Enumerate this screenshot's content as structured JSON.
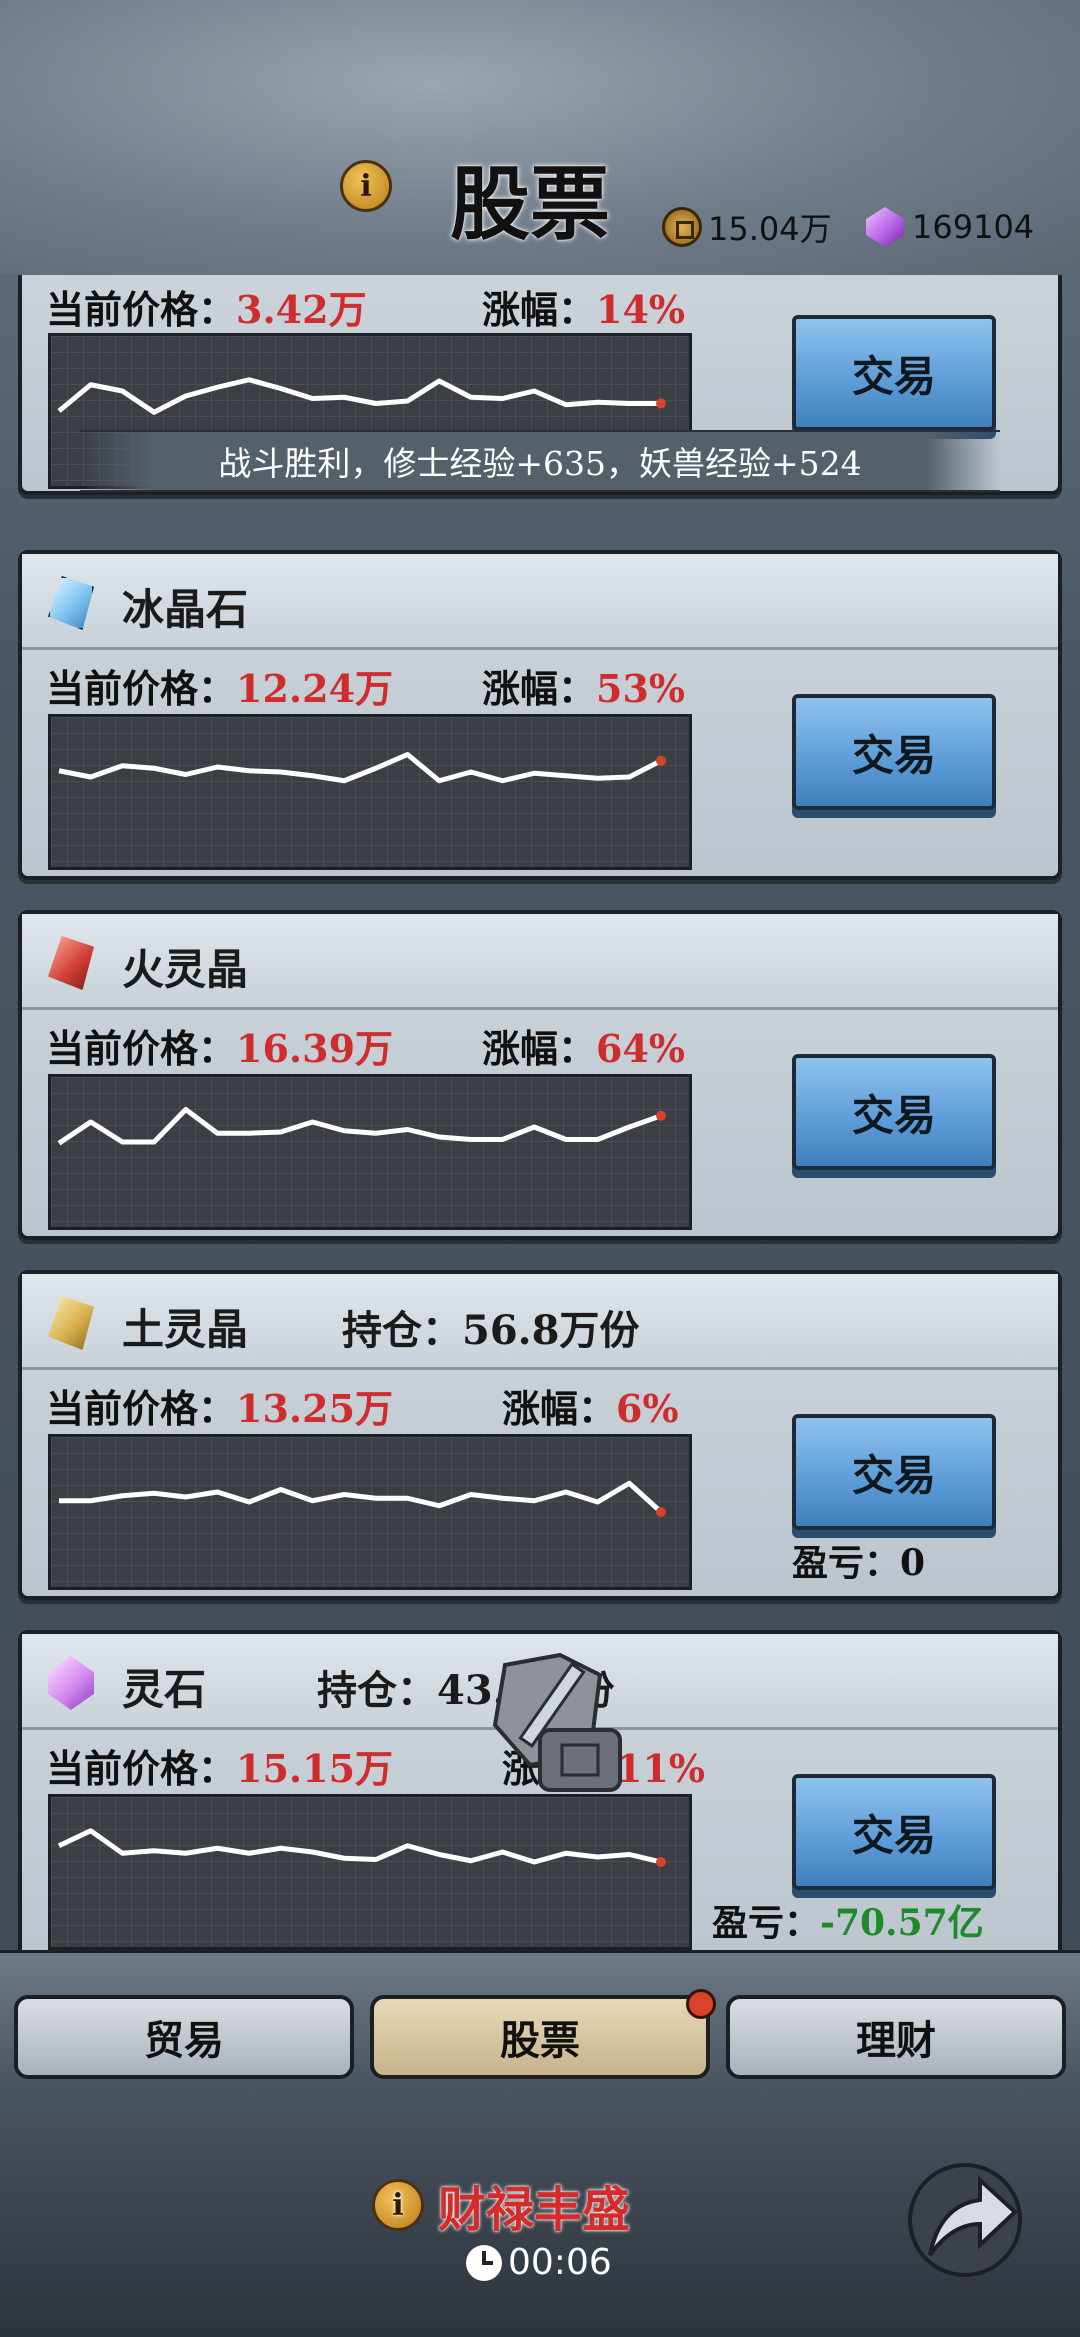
{
  "header": {
    "title": "股票",
    "coins": "15.04万",
    "gems": "169104"
  },
  "toast": "战斗胜利，修士经验+635，妖兽经验+524",
  "labels": {
    "price": "当前价格：",
    "change": "涨幅：",
    "hold": "持仓：",
    "pl": "盈亏：",
    "trade": "交易"
  },
  "stocks": [
    {
      "name": "",
      "price": "3.42万",
      "change": "14%",
      "icon": "none",
      "series": [
        6.0,
        8.1,
        7.6,
        5.9,
        7.2,
        7.9,
        8.5,
        7.8,
        7.0,
        7.1,
        6.6,
        6.8,
        8.4,
        7.1,
        7.0,
        7.6,
        6.5,
        6.7,
        6.6,
        6.6
      ]
    },
    {
      "name": "冰晶石",
      "price": "12.24万",
      "change": "53%",
      "icon": "ice-crystal-icon",
      "series": [
        7.7,
        7.2,
        8.1,
        7.9,
        7.4,
        8.0,
        7.7,
        7.6,
        7.3,
        6.9,
        7.9,
        9.0,
        6.9,
        7.6,
        6.9,
        7.5,
        7.3,
        7.1,
        7.2,
        8.5
      ]
    },
    {
      "name": "火灵晶",
      "price": "16.39万",
      "change": "64%",
      "icon": "fire-crystal-icon",
      "series": [
        6.7,
        8.4,
        6.8,
        6.8,
        9.4,
        7.5,
        7.5,
        7.6,
        8.4,
        7.7,
        7.5,
        7.8,
        7.2,
        7.0,
        7.0,
        8.0,
        7.0,
        7.0,
        8.0,
        8.9
      ]
    },
    {
      "name": "土灵晶",
      "price": "13.25万",
      "change": "6%",
      "icon": "earth-crystal-icon",
      "hold": "56.8万份",
      "pl": "0",
      "plColor": "#111111",
      "series": [
        6.9,
        6.9,
        7.3,
        7.5,
        7.2,
        7.6,
        6.8,
        7.8,
        6.9,
        7.4,
        7.1,
        7.1,
        6.5,
        7.4,
        7.1,
        6.9,
        7.6,
        6.8,
        8.3,
        6.0
      ]
    },
    {
      "name": "灵石",
      "price": "15.15万",
      "change": "11%",
      "icon": "spirit-stone-icon",
      "hold": "43.4万份",
      "pl": "-70.57亿",
      "plColor": "#1f8a2c",
      "series": [
        8.1,
        9.3,
        7.5,
        7.7,
        7.5,
        7.9,
        7.5,
        7.9,
        7.6,
        7.1,
        7.0,
        8.1,
        7.4,
        6.9,
        7.6,
        6.8,
        7.5,
        7.2,
        7.4,
        6.8
      ]
    }
  ],
  "tabs": [
    {
      "label": "贸易",
      "active": false
    },
    {
      "label": "股票",
      "active": true
    },
    {
      "label": "理财",
      "active": false
    }
  ],
  "footer": {
    "title": "财禄丰盛",
    "timer": "00:06"
  },
  "colors": {
    "price_red": "#cf2d2d",
    "chart_line": "#ffffff",
    "end_dot": "#d9432c",
    "trade_blue": "#5b9bd6"
  }
}
